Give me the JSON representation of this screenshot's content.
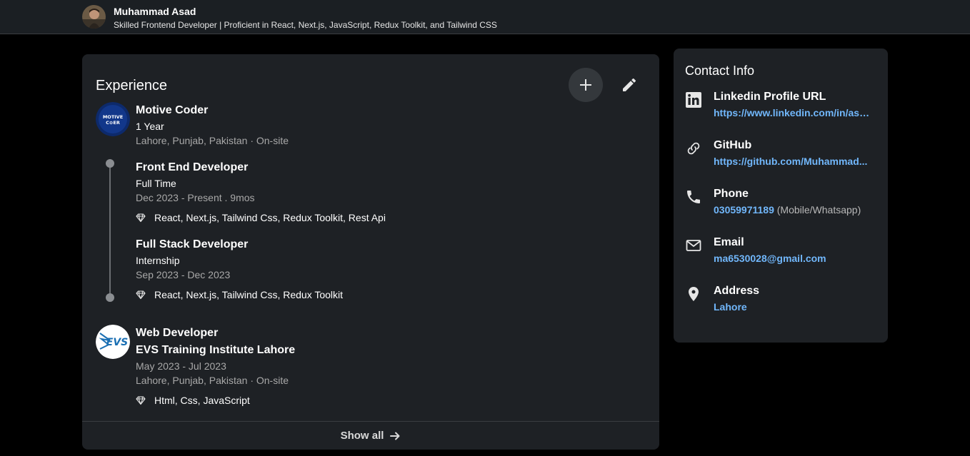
{
  "topbar": {
    "name": "Muhammad Asad",
    "headline": "Skilled Frontend Developer | Proficient in React, Next.js, JavaScript, Redux Toolkit, and Tailwind CSS"
  },
  "experience": {
    "title": "Experience",
    "company1": {
      "name": "Motive Coder",
      "logo_text_line1": "MOTIVE",
      "logo_text_line2": "C⊙ER",
      "duration": "1 Year",
      "location": "Lahore, Punjab, Pakistan · On-site",
      "roles": [
        {
          "title": "Front End Developer",
          "type": "Full Time",
          "dates": "Dec 2023 - Present . 9mos",
          "skills": "React, Next.js, Tailwind Css, Redux Toolkit, Rest Api"
        },
        {
          "title": "Full Stack Developer",
          "type": "Internship",
          "dates": "Sep 2023 - Dec 2023",
          "skills": "React, Next.js, Tailwind Css, Redux Toolkit"
        }
      ]
    },
    "company2": {
      "role": "Web Developer",
      "name": "EVS Training Institute Lahore",
      "logo_text": "EVS",
      "dates": "May 2023 - Jul 2023",
      "location": "Lahore, Punjab, Pakistan · On-site",
      "skills": "Html, Css, JavaScript"
    },
    "show_all_label": "Show all"
  },
  "contact": {
    "title": "Contact Info",
    "items": [
      {
        "icon": "linkedin-icon",
        "label": "Linkedin Profile URL",
        "value": "https://www.linkedin.com/in/asa..."
      },
      {
        "icon": "link-icon",
        "label": "GitHub",
        "value": "https://github.com/Muhammad..."
      },
      {
        "icon": "phone-icon",
        "label": "Phone",
        "value": "03059971189",
        "note": "(Mobile/Whatsapp)"
      },
      {
        "icon": "mail-icon",
        "label": "Email",
        "value": "ma6530028@gmail.com"
      },
      {
        "icon": "location-pin-icon",
        "label": "Address",
        "value": "Lahore"
      }
    ]
  },
  "colors": {
    "background": "#000000",
    "card": "#1e2125",
    "link": "#71b7fb",
    "muted_text": "#a8a8a8"
  }
}
